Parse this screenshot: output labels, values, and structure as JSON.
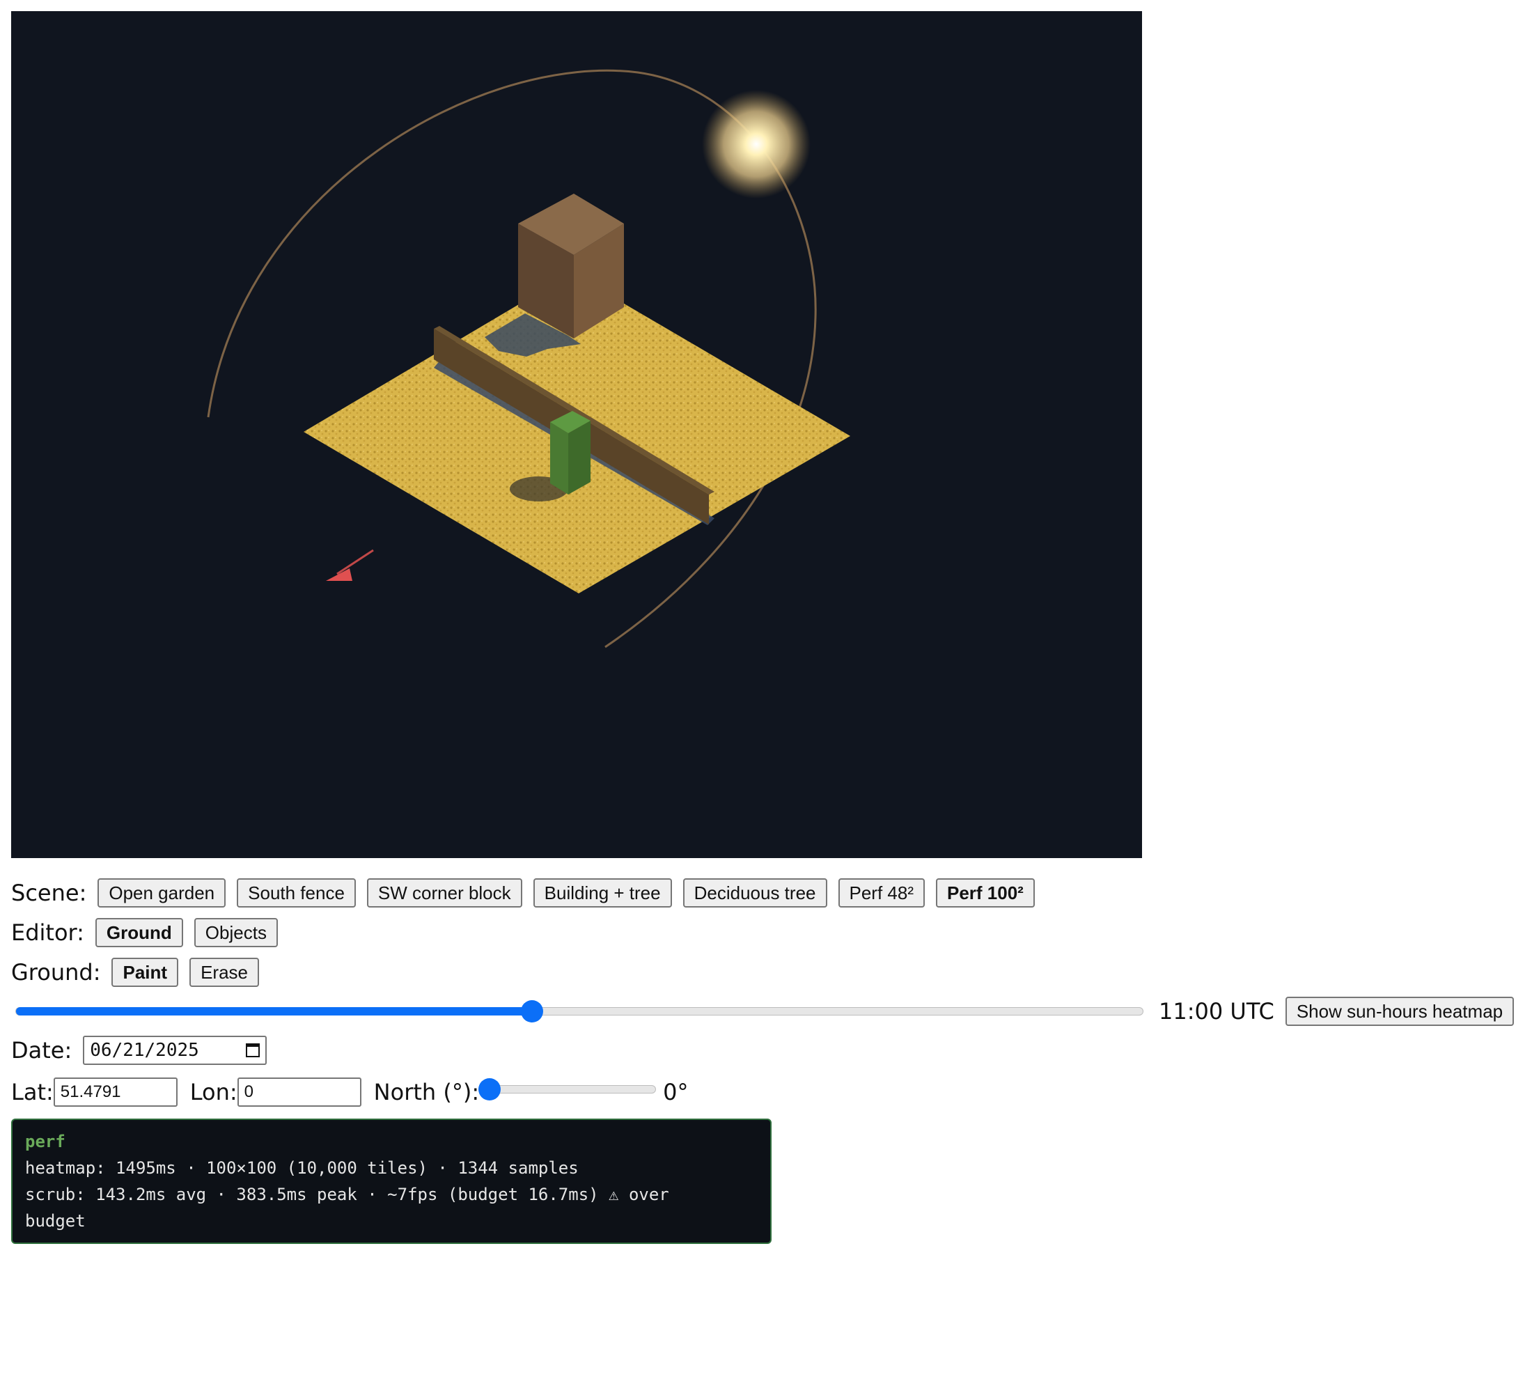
{
  "scene_row": {
    "label": "Scene:",
    "buttons": [
      "Open garden",
      "South fence",
      "SW corner block",
      "Building + tree",
      "Deciduous tree",
      "Perf 48²",
      "Perf 100²"
    ],
    "active": "Perf 100²"
  },
  "editor_row": {
    "label": "Editor:",
    "buttons": [
      "Ground",
      "Objects"
    ],
    "active": "Ground"
  },
  "ground_row": {
    "label": "Ground:",
    "buttons": [
      "Paint",
      "Erase"
    ],
    "active": "Paint"
  },
  "time": {
    "fraction": 0.458,
    "label": "11:00 UTC",
    "heatmap_button": "Show sun-hours heatmap"
  },
  "date": {
    "label": "Date:",
    "value": "06/21/2025"
  },
  "location": {
    "lat_label": "Lat:",
    "lat_value": "51.4791",
    "lon_label": "Lon:",
    "lon_value": "0",
    "north_label": "North (°):",
    "north_fraction": 0,
    "north_value": "0°"
  },
  "perf": {
    "title": "perf",
    "heatmap_line": "heatmap: 1495ms · 100×100 (10,000 tiles) · 1344 samples",
    "scrub_line": "scrub: 143.2ms avg · 383.5ms peak · ~7fps (budget 16.7ms) ⚠ over",
    "scrub_line_cont": "budget"
  },
  "colors": {
    "scene_bg": "#10151f",
    "ground": "#d9b54a",
    "building": "#8a6a4a",
    "tree": "#5a8a3c",
    "fence": "#5a4428",
    "sun": "#fff3c4",
    "sun_path": "#8a6c4a",
    "accent": "#0b6ff7",
    "north_arrow": "#e05050"
  },
  "icons": {
    "calendar": "calendar-icon",
    "north": "north-arrow-icon",
    "sun": "sun-icon"
  }
}
